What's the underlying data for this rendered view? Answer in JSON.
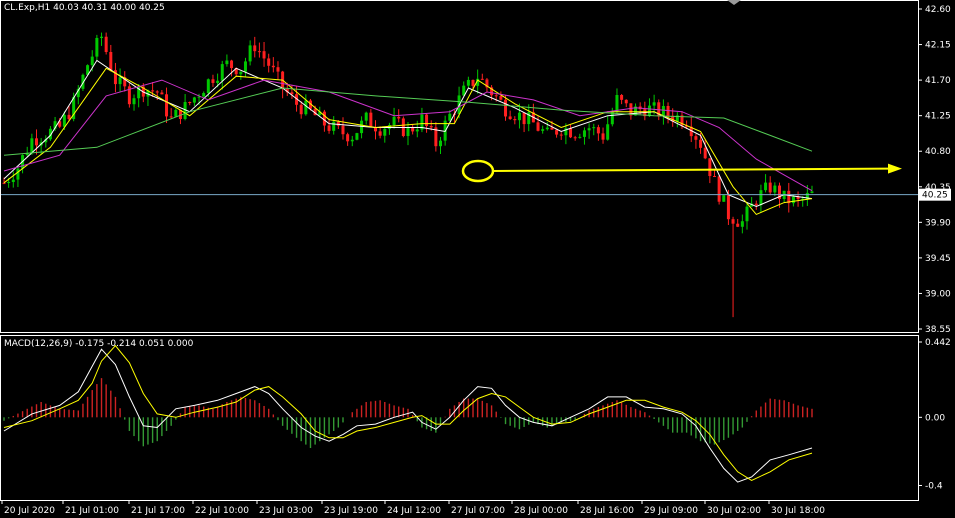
{
  "header": {
    "price": "CL.Exp,H1  40.03 40.31 40.00 40.25",
    "macd": "MACD(12,26,9) -0.175 -0.214 0.051 0.000"
  },
  "colors": {
    "background": "#000000",
    "axis": "#ffffff",
    "bull": "#00c800",
    "bear": "#ff2020",
    "ma_fast": "#ffffff",
    "ma_slow": "#ffff00",
    "ma_mid": "#cc33cc",
    "ma_long": "#55cc55",
    "current_line": "#7aa9c8",
    "annotation": "#ffff00",
    "macd_pos": "#cc2222",
    "macd_neg": "#339933",
    "macd_main": "#ffffff",
    "macd_signal": "#ffff00"
  },
  "chart_data": [
    {
      "type": "candlestick",
      "symbol": "CL.Exp,H1",
      "ylim": [
        38.55,
        42.6
      ],
      "y_ticks": [
        "42.60",
        "42.15",
        "41.70",
        "41.25",
        "40.80",
        "40.35",
        "39.90",
        "39.45",
        "39.00",
        "38.55"
      ],
      "current_price": "40.25",
      "x_ticks": [
        "20 Jul 2020",
        "21 Jul 01:00",
        "21 Jul 17:00",
        "22 Jul 10:00",
        "23 Jul 03:00",
        "23 Jul 19:00",
        "24 Jul 12:00",
        "27 Jul 07:00",
        "28 Jul 00:00",
        "28 Jul 16:00",
        "29 Jul 09:00",
        "30 Jul 02:00",
        "30 Jul 18:00"
      ],
      "close_path": [
        [
          0,
          40.4
        ],
        [
          3,
          40.6
        ],
        [
          6,
          40.95
        ],
        [
          9,
          41.02
        ],
        [
          12,
          41.1
        ],
        [
          15,
          41.4
        ],
        [
          18,
          41.9
        ],
        [
          21,
          42.25
        ],
        [
          24,
          41.7
        ],
        [
          27,
          41.5
        ],
        [
          30,
          41.6
        ],
        [
          33,
          41.55
        ],
        [
          36,
          41.2
        ],
        [
          39,
          41.35
        ],
        [
          42,
          41.55
        ],
        [
          45,
          41.75
        ],
        [
          48,
          41.9
        ],
        [
          51,
          41.85
        ],
        [
          54,
          42.15
        ],
        [
          57,
          41.9
        ],
        [
          60,
          41.6
        ],
        [
          63,
          41.4
        ],
        [
          66,
          41.3
        ],
        [
          69,
          41.15
        ],
        [
          72,
          41.05
        ],
        [
          75,
          41.0
        ],
        [
          78,
          41.2
        ],
        [
          81,
          41.1
        ],
        [
          84,
          41.15
        ],
        [
          87,
          41.05
        ],
        [
          90,
          41.2
        ],
        [
          93,
          40.9
        ],
        [
          96,
          41.25
        ],
        [
          99,
          41.55
        ],
        [
          102,
          41.75
        ],
        [
          105,
          41.55
        ],
        [
          108,
          41.35
        ],
        [
          111,
          41.25
        ],
        [
          114,
          41.15
        ],
        [
          117,
          41.0
        ],
        [
          120,
          41.1
        ],
        [
          123,
          41.05
        ],
        [
          126,
          41.1
        ],
        [
          129,
          41.0
        ],
        [
          132,
          41.45
        ],
        [
          135,
          41.3
        ],
        [
          138,
          41.35
        ],
        [
          141,
          41.3
        ],
        [
          144,
          41.25
        ],
        [
          147,
          41.2
        ],
        [
          150,
          40.9
        ],
        [
          153,
          40.4
        ],
        [
          156,
          40.0
        ],
        [
          159,
          39.9
        ],
        [
          162,
          40.2
        ],
        [
          165,
          40.35
        ],
        [
          168,
          40.2
        ],
        [
          171,
          40.15
        ],
        [
          174,
          40.25
        ]
      ],
      "moving_averages": [
        {
          "name": "fast",
          "points": [
            [
              0,
              40.45
            ],
            [
              10,
              41.0
            ],
            [
              20,
              41.95
            ],
            [
              30,
              41.55
            ],
            [
              40,
              41.3
            ],
            [
              50,
              41.85
            ],
            [
              60,
              41.6
            ],
            [
              70,
              41.15
            ],
            [
              80,
              41.1
            ],
            [
              90,
              41.1
            ],
            [
              95,
              41.05
            ],
            [
              100,
              41.6
            ],
            [
              110,
              41.35
            ],
            [
              120,
              41.05
            ],
            [
              130,
              41.25
            ],
            [
              140,
              41.3
            ],
            [
              150,
              41.0
            ],
            [
              156,
              40.25
            ],
            [
              162,
              40.1
            ],
            [
              168,
              40.25
            ],
            [
              174,
              40.2
            ]
          ]
        },
        {
          "name": "slow",
          "points": [
            [
              0,
              40.4
            ],
            [
              10,
              40.85
            ],
            [
              22,
              41.85
            ],
            [
              30,
              41.6
            ],
            [
              40,
              41.25
            ],
            [
              50,
              41.75
            ],
            [
              60,
              41.7
            ],
            [
              70,
              41.2
            ],
            [
              80,
              41.1
            ],
            [
              90,
              41.15
            ],
            [
              97,
              41.15
            ],
            [
              102,
              41.7
            ],
            [
              110,
              41.4
            ],
            [
              120,
              41.1
            ],
            [
              130,
              41.3
            ],
            [
              140,
              41.3
            ],
            [
              150,
              41.05
            ],
            [
              157,
              40.35
            ],
            [
              162,
              40.0
            ],
            [
              168,
              40.15
            ],
            [
              174,
              40.2
            ]
          ]
        },
        {
          "name": "mid",
          "points": [
            [
              0,
              40.55
            ],
            [
              12,
              40.75
            ],
            [
              22,
              41.5
            ],
            [
              34,
              41.7
            ],
            [
              44,
              41.45
            ],
            [
              56,
              41.7
            ],
            [
              70,
              41.55
            ],
            [
              84,
              41.25
            ],
            [
              96,
              41.3
            ],
            [
              104,
              41.55
            ],
            [
              114,
              41.45
            ],
            [
              124,
              41.25
            ],
            [
              136,
              41.35
            ],
            [
              146,
              41.3
            ],
            [
              154,
              41.1
            ],
            [
              162,
              40.7
            ],
            [
              168,
              40.5
            ],
            [
              174,
              40.3
            ]
          ]
        },
        {
          "name": "long",
          "points": [
            [
              0,
              40.75
            ],
            [
              20,
              40.85
            ],
            [
              40,
              41.3
            ],
            [
              60,
              41.6
            ],
            [
              80,
              41.5
            ],
            [
              100,
              41.42
            ],
            [
              120,
              41.32
            ],
            [
              140,
              41.25
            ],
            [
              155,
              41.22
            ],
            [
              165,
              41.0
            ],
            [
              174,
              40.8
            ]
          ]
        }
      ],
      "annotation": {
        "shape": "ellipse + arrow",
        "at_price": 40.55,
        "points_to": "right"
      }
    },
    {
      "type": "macd",
      "title": "MACD(12,26,9) -0.175 -0.214 0.051 0.000",
      "params": [
        12,
        26,
        9
      ],
      "values": {
        "main": -0.175,
        "signal": -0.214,
        "histogram": 0.051,
        "extra": 0.0
      },
      "ylim": [
        -0.45,
        0.442
      ],
      "y_ticks": [
        "0.442",
        "0.00",
        "-0.4"
      ],
      "histogram": [
        [
          0,
          -0.02
        ],
        [
          5,
          0.05
        ],
        [
          8,
          0.09
        ],
        [
          12,
          0.05
        ],
        [
          16,
          0.04
        ],
        [
          19,
          0.16
        ],
        [
          21,
          0.23
        ],
        [
          24,
          0.12
        ],
        [
          27,
          -0.08
        ],
        [
          30,
          -0.17
        ],
        [
          33,
          -0.14
        ],
        [
          36,
          -0.05
        ],
        [
          39,
          0.06
        ],
        [
          42,
          0.07
        ],
        [
          45,
          0.05
        ],
        [
          48,
          0.09
        ],
        [
          51,
          0.12
        ],
        [
          54,
          0.1
        ],
        [
          57,
          0.05
        ],
        [
          60,
          -0.05
        ],
        [
          63,
          -0.12
        ],
        [
          66,
          -0.18
        ],
        [
          69,
          -0.12
        ],
        [
          72,
          -0.06
        ],
        [
          75,
          0.03
        ],
        [
          78,
          0.09
        ],
        [
          81,
          0.1
        ],
        [
          84,
          0.07
        ],
        [
          87,
          0.05
        ],
        [
          90,
          -0.06
        ],
        [
          93,
          -0.09
        ],
        [
          96,
          0.05
        ],
        [
          99,
          0.11
        ],
        [
          102,
          0.11
        ],
        [
          105,
          0.07
        ],
        [
          108,
          -0.04
        ],
        [
          111,
          -0.07
        ],
        [
          114,
          -0.03
        ],
        [
          117,
          -0.06
        ],
        [
          120,
          -0.03
        ],
        [
          123,
          -0.02
        ],
        [
          126,
          0.04
        ],
        [
          129,
          0.07
        ],
        [
          132,
          0.1
        ],
        [
          135,
          0.06
        ],
        [
          138,
          0.03
        ],
        [
          141,
          -0.03
        ],
        [
          144,
          -0.09
        ],
        [
          147,
          -0.09
        ],
        [
          150,
          -0.14
        ],
        [
          153,
          -0.16
        ],
        [
          156,
          -0.12
        ],
        [
          159,
          -0.06
        ],
        [
          162,
          0.04
        ],
        [
          165,
          0.11
        ],
        [
          168,
          0.1
        ],
        [
          171,
          0.07
        ],
        [
          174,
          0.05
        ]
      ],
      "main_line": [
        [
          0,
          -0.08
        ],
        [
          6,
          0.02
        ],
        [
          12,
          0.07
        ],
        [
          16,
          0.15
        ],
        [
          19,
          0.3
        ],
        [
          21,
          0.4
        ],
        [
          24,
          0.31
        ],
        [
          27,
          0.12
        ],
        [
          30,
          -0.05
        ],
        [
          33,
          -0.06
        ],
        [
          37,
          0.05
        ],
        [
          41,
          0.07
        ],
        [
          46,
          0.1
        ],
        [
          50,
          0.14
        ],
        [
          54,
          0.18
        ],
        [
          57,
          0.14
        ],
        [
          60,
          0.05
        ],
        [
          64,
          -0.06
        ],
        [
          67,
          -0.11
        ],
        [
          70,
          -0.14
        ],
        [
          73,
          -0.1
        ],
        [
          76,
          -0.05
        ],
        [
          80,
          -0.04
        ],
        [
          84,
          0.0
        ],
        [
          88,
          0.03
        ],
        [
          90,
          -0.03
        ],
        [
          93,
          -0.07
        ],
        [
          96,
          0.0
        ],
        [
          99,
          0.1
        ],
        [
          102,
          0.18
        ],
        [
          105,
          0.17
        ],
        [
          108,
          0.07
        ],
        [
          111,
          0.0
        ],
        [
          114,
          -0.03
        ],
        [
          118,
          -0.05
        ],
        [
          122,
          0.0
        ],
        [
          126,
          0.05
        ],
        [
          130,
          0.12
        ],
        [
          134,
          0.12
        ],
        [
          138,
          0.06
        ],
        [
          142,
          0.05
        ],
        [
          146,
          0.02
        ],
        [
          149,
          -0.05
        ],
        [
          152,
          -0.18
        ],
        [
          155,
          -0.3
        ],
        [
          158,
          -0.38
        ],
        [
          161,
          -0.35
        ],
        [
          165,
          -0.25
        ],
        [
          169,
          -0.22
        ],
        [
          174,
          -0.18
        ]
      ],
      "signal_line": [
        [
          0,
          -0.06
        ],
        [
          6,
          -0.02
        ],
        [
          12,
          0.05
        ],
        [
          16,
          0.1
        ],
        [
          19,
          0.2
        ],
        [
          21,
          0.33
        ],
        [
          24,
          0.42
        ],
        [
          27,
          0.32
        ],
        [
          30,
          0.14
        ],
        [
          33,
          0.02
        ],
        [
          37,
          0.0
        ],
        [
          41,
          0.03
        ],
        [
          46,
          0.06
        ],
        [
          50,
          0.09
        ],
        [
          54,
          0.16
        ],
        [
          57,
          0.18
        ],
        [
          60,
          0.12
        ],
        [
          64,
          0.02
        ],
        [
          67,
          -0.08
        ],
        [
          70,
          -0.12
        ],
        [
          73,
          -0.12
        ],
        [
          76,
          -0.08
        ],
        [
          80,
          -0.06
        ],
        [
          84,
          -0.03
        ],
        [
          88,
          0.0
        ],
        [
          90,
          0.01
        ],
        [
          93,
          -0.04
        ],
        [
          96,
          -0.04
        ],
        [
          99,
          0.04
        ],
        [
          102,
          0.11
        ],
        [
          105,
          0.14
        ],
        [
          108,
          0.12
        ],
        [
          111,
          0.06
        ],
        [
          114,
          0.0
        ],
        [
          118,
          -0.04
        ],
        [
          122,
          -0.03
        ],
        [
          126,
          0.02
        ],
        [
          130,
          0.06
        ],
        [
          134,
          0.1
        ],
        [
          138,
          0.1
        ],
        [
          142,
          0.06
        ],
        [
          146,
          0.03
        ],
        [
          149,
          -0.02
        ],
        [
          152,
          -0.1
        ],
        [
          155,
          -0.22
        ],
        [
          158,
          -0.32
        ],
        [
          161,
          -0.37
        ],
        [
          165,
          -0.32
        ],
        [
          169,
          -0.25
        ],
        [
          174,
          -0.21
        ]
      ]
    }
  ]
}
